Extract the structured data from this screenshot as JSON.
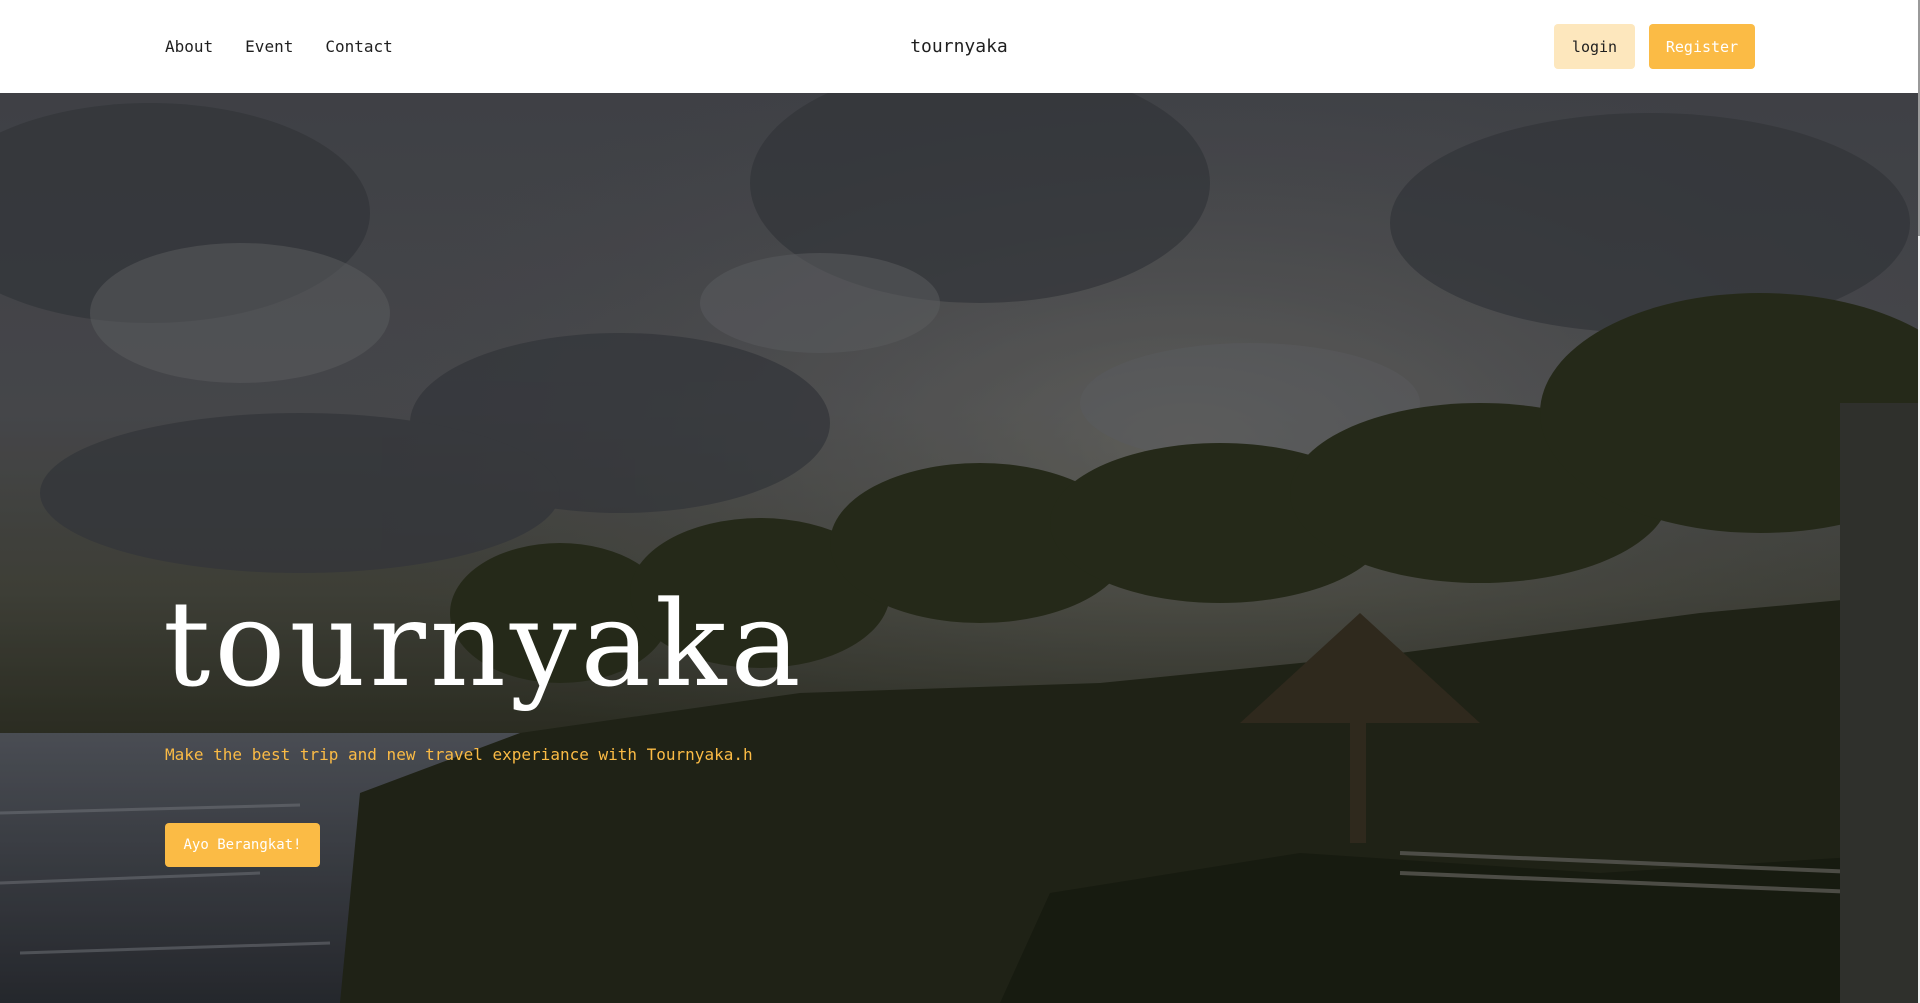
{
  "nav": {
    "links": [
      "About",
      "Event",
      "Contact"
    ],
    "brand": "tournyaka",
    "login_label": "login",
    "register_label": "Register"
  },
  "hero": {
    "title": "tournyaka",
    "subtitle": "Make the best trip and new travel experiance with Tournyaka.h",
    "cta_label": "Ayo Berangkat!"
  },
  "colors": {
    "accent": "#fbbb45",
    "accent_light": "#fde7bd",
    "text_dark": "#1f1f1f",
    "white": "#ffffff"
  }
}
